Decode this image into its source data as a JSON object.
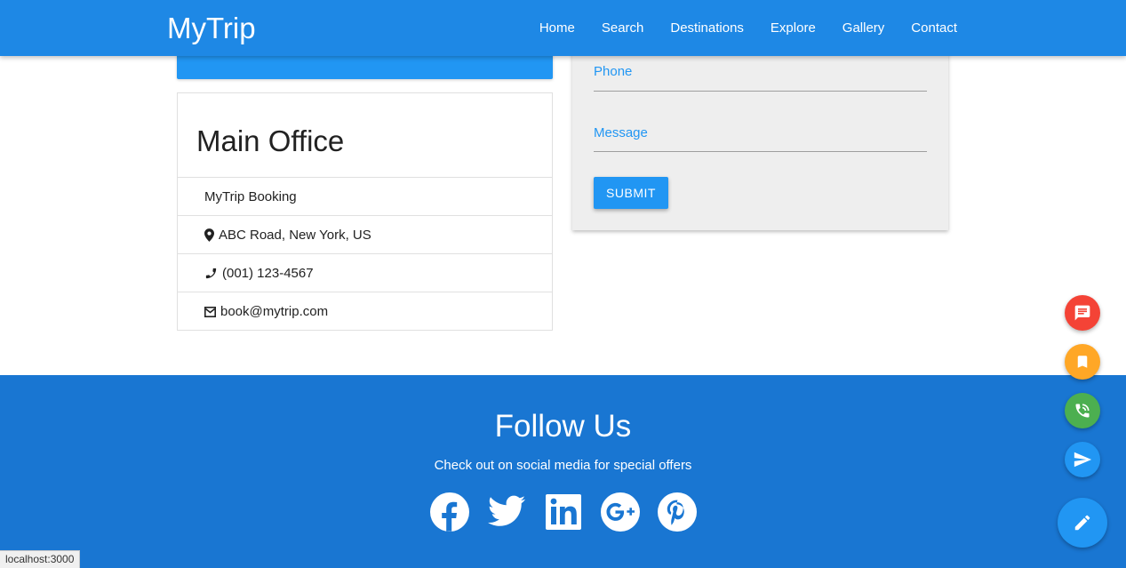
{
  "brand": "MyTrip",
  "nav": [
    {
      "label": "Home"
    },
    {
      "label": "Search"
    },
    {
      "label": "Destinations"
    },
    {
      "label": "Explore"
    },
    {
      "label": "Gallery"
    },
    {
      "label": "Contact"
    }
  ],
  "office": {
    "title": "Main Office",
    "name": "MyTrip Booking",
    "address": "ABC Road, New York, US",
    "phone": "(001) 123-4567",
    "email": "book@mytrip.com"
  },
  "form": {
    "phone_label": "Phone",
    "message_label": "Message",
    "submit_label": "SUBMIT"
  },
  "footer": {
    "title": "Follow Us",
    "subtitle": "Check out on social media for special offers",
    "social": [
      "facebook-icon",
      "twitter-icon",
      "linkedin-icon",
      "google-plus-icon",
      "pinterest-icon"
    ]
  },
  "fabs": [
    {
      "icon": "chat-icon",
      "color": "#f44336"
    },
    {
      "icon": "bookmark-icon",
      "color": "#ffa726"
    },
    {
      "icon": "phone-icon",
      "color": "#4caf50"
    },
    {
      "icon": "send-icon",
      "color": "#2196f3"
    },
    {
      "icon": "edit-icon",
      "color": "#2196f3"
    }
  ],
  "status_bar": "localhost:3000",
  "colors": {
    "navbar": "#1e88e5",
    "footer": "#1976d2",
    "accent": "#2196f3",
    "form_bg": "#eeeeee"
  }
}
